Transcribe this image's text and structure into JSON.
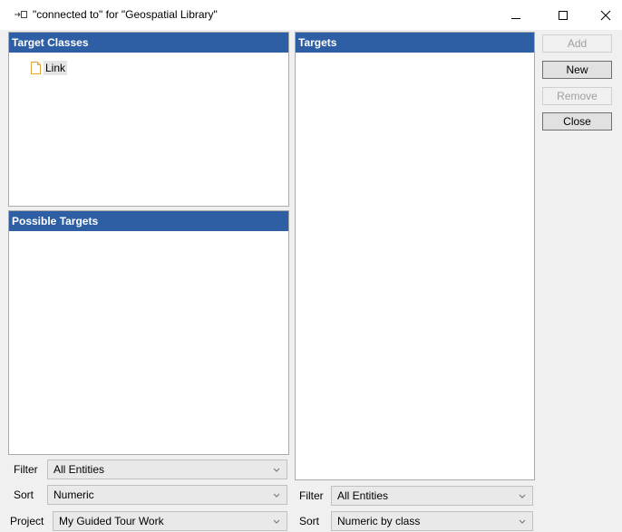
{
  "window": {
    "title": "\"connected to\" for \"Geospatial Library\"",
    "title_icon": "arrow-to-box-icon",
    "controls": {
      "minimize": "minimize-icon",
      "maximize": "maximize-icon",
      "close": "close-icon"
    }
  },
  "target_classes": {
    "header": "Target Classes",
    "items": [
      {
        "label": "Link",
        "icon": "document-icon"
      }
    ]
  },
  "possible_targets": {
    "header": "Possible Targets"
  },
  "targets": {
    "header": "Targets"
  },
  "buttons": {
    "add": "Add",
    "new": "New",
    "remove": "Remove",
    "close": "Close"
  },
  "left_controls": {
    "filter_label": "Filter",
    "filter_value": "All Entities",
    "sort_label": "Sort",
    "sort_value": "Numeric",
    "project_label": "Project",
    "project_value": "My Guided Tour Work"
  },
  "right_controls": {
    "filter_label": "Filter",
    "filter_value": "All Entities",
    "sort_label": "Sort",
    "sort_value": "Numeric by class"
  },
  "colors": {
    "header_bg": "#2e5ea4",
    "header_text": "#ffffff",
    "window_bg": "#f0f0f0",
    "disabled_text": "#a0a0a0",
    "doc_icon": "#e8a33c"
  }
}
